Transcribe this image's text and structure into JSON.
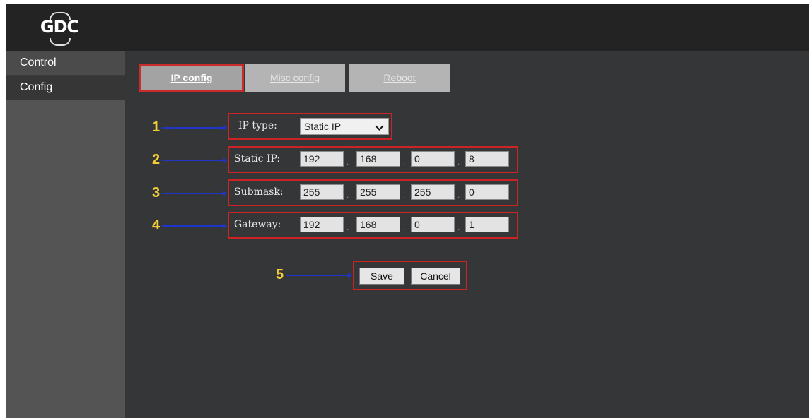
{
  "header": {
    "logo_text": "GDC"
  },
  "sidebar": {
    "items": [
      {
        "label": "Control"
      },
      {
        "label": "Config"
      }
    ]
  },
  "tabs": [
    {
      "label": "IP config"
    },
    {
      "label": "Misc config"
    },
    {
      "label": "Reboot"
    }
  ],
  "annotations": {
    "labels": [
      "1",
      "2",
      "3",
      "4",
      "5"
    ]
  },
  "form": {
    "ip_type": {
      "label": "IP type:",
      "selected": "Static IP"
    },
    "static_ip": {
      "label": "Static IP:",
      "octets": [
        "192",
        "168",
        "0",
        "8"
      ]
    },
    "submask": {
      "label": "Submask:",
      "octets": [
        "255",
        "255",
        "255",
        "0"
      ]
    },
    "gateway": {
      "label": "Gateway:",
      "octets": [
        "192",
        "168",
        "0",
        "1"
      ]
    },
    "octet_separator": "."
  },
  "actions": {
    "save_label": "Save",
    "cancel_label": "Cancel"
  },
  "colors": {
    "highlight": "#cc2424",
    "arrow": "#1f34c8",
    "number": "#f3cc3a"
  }
}
